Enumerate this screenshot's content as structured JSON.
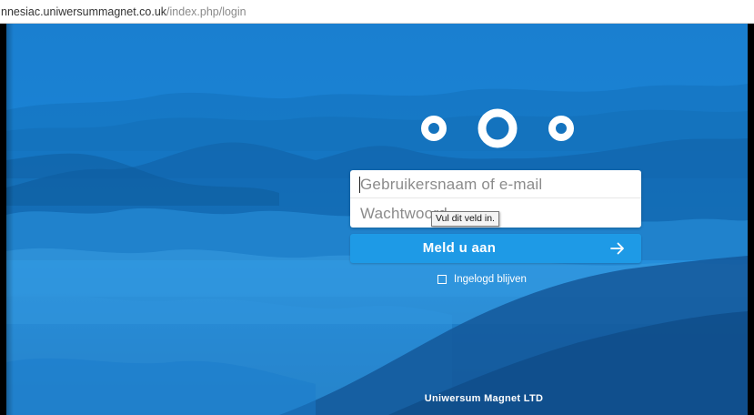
{
  "browser": {
    "url_host": "nnesiac.uniwersummagnet.co.uk",
    "url_path": "/index.php/login"
  },
  "login": {
    "username_placeholder": "Gebruikersnaam of e-mail",
    "password_placeholder": "Wachtwoord",
    "validation_tooltip": "Vul dit veld in.",
    "submit_label": "Meld u aan",
    "remember_label": "Ingelogd blijven"
  },
  "footer": {
    "text": "Uniwersum Magnet LTD"
  },
  "colors": {
    "background": "#1a83d5",
    "button": "#1e9ae6",
    "text_on_blue": "#ffffff",
    "placeholder": "#8b8b8b"
  },
  "icons": {
    "logo": "nextcloud-logo-icon",
    "submit": "arrow-right-icon",
    "checkbox": "checkbox-icon"
  }
}
